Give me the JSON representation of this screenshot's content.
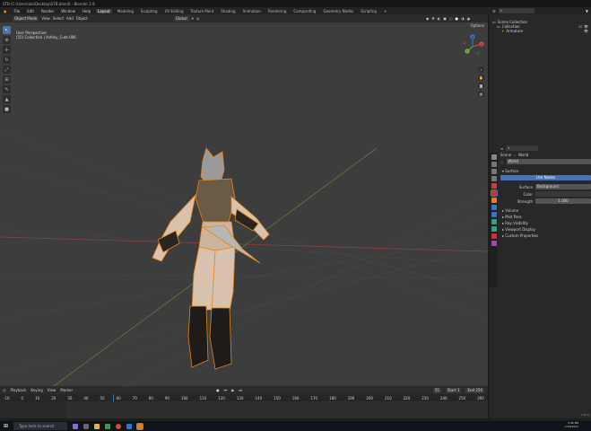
{
  "window": {
    "title": "STB (C:\\Users\\ole\\Desktop\\STB.blend) - Blender 2.8"
  },
  "menu": [
    "File",
    "Edit",
    "Render",
    "Window",
    "Help"
  ],
  "workspaces": [
    "Layout",
    "Modeling",
    "Sculpting",
    "UV Editing",
    "Texture Paint",
    "Shading",
    "Animation",
    "Rendering",
    "Compositing",
    "Geometry Nodes",
    "Scripting"
  ],
  "active_workspace": "Layout",
  "scene": {
    "label": "Scene",
    "view_layer": "ViewLayer"
  },
  "viewport": {
    "mode": "Object Mode",
    "menus": [
      "View",
      "Select",
      "Add",
      "Object"
    ],
    "transform": "Global",
    "options": "Options",
    "info_line1": "User Perspective",
    "info_line2": "(55) Collection | Ashley_Cute.006",
    "gizmo_axes": [
      "X",
      "Y",
      "Z"
    ]
  },
  "outliner": {
    "root": "Scene Collection",
    "collection": "Collection",
    "object": "Armature"
  },
  "properties": {
    "breadcrumb": [
      "Scene",
      "World"
    ],
    "world_name": "World",
    "surface_section": "Surface",
    "use_nodes": "Use Nodes",
    "rows": [
      {
        "label": "Surface",
        "value": "Background"
      },
      {
        "label": "Color",
        "value": ""
      },
      {
        "label": "Strength",
        "value": "1.000"
      }
    ],
    "panels": [
      "Volume",
      "Mist Pass",
      "Ray Visibility",
      "Viewport Display",
      "Custom Properties"
    ]
  },
  "timeline": {
    "menus": [
      "Playback",
      "Keying",
      "View",
      "Marker"
    ],
    "current_frame": "55",
    "start": "Start",
    "start_value": "1",
    "end": "End",
    "end_value": "250",
    "ticks": [
      "-10",
      "0",
      "10",
      "20",
      "30",
      "40",
      "50",
      "60",
      "70",
      "80",
      "90",
      "100",
      "110",
      "120",
      "130",
      "140",
      "150",
      "160",
      "170",
      "180",
      "190",
      "200",
      "210",
      "220",
      "230",
      "240",
      "250",
      "260"
    ]
  },
  "taskbar": {
    "search": "Type here to search",
    "time": "3:45 PM",
    "date": "7/16/2021",
    "version": "2.80.0"
  },
  "colors": {
    "accent": "#4772b3",
    "viewport_bg": "#3d3d3d",
    "selection": "#e3831c"
  }
}
